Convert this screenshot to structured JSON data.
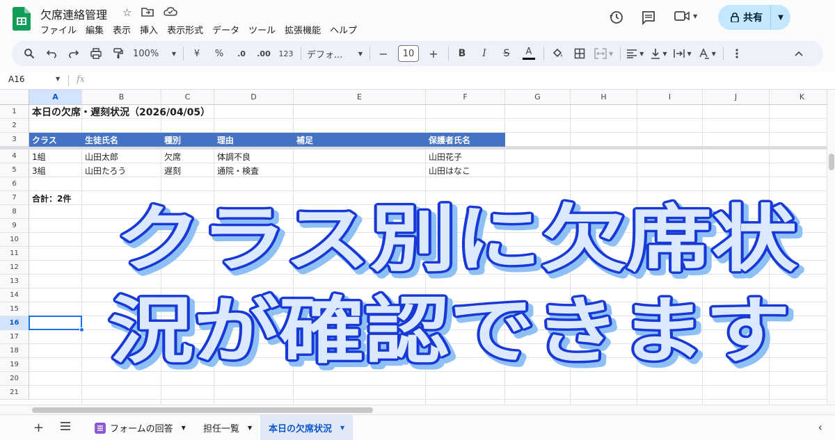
{
  "app": {
    "doc_title": "欠席連絡管理",
    "menu": [
      "ファイル",
      "編集",
      "表示",
      "挿入",
      "表示形式",
      "データ",
      "ツール",
      "拡張機能",
      "ヘルプ"
    ],
    "share_label": "共有"
  },
  "toolbar": {
    "zoom": "100%",
    "currency": "¥",
    "percent": "%",
    "dec_less": ".0",
    "dec_more": ".00",
    "number_format": "123",
    "font_name": "デフォ...",
    "font_size": "10",
    "bold": "B",
    "italic": "I",
    "strike": "S",
    "text_color": "A"
  },
  "formula_bar": {
    "name_box": "A16",
    "fx": "fx"
  },
  "columns": [
    "A",
    "B",
    "C",
    "D",
    "E",
    "F",
    "G",
    "H",
    "I",
    "J",
    "K"
  ],
  "rows": [
    "1",
    "2",
    "3",
    "4",
    "5",
    "6",
    "7",
    "8",
    "9",
    "10",
    "11",
    "12",
    "13",
    "14",
    "15",
    "16",
    "17",
    "18",
    "19",
    "20",
    "21"
  ],
  "selected_cell": {
    "col": "A",
    "row": "16"
  },
  "sheet": {
    "title": "本日の欠席・遅刻状況（2026/04/05）",
    "headers": [
      "クラス",
      "生徒氏名",
      "種別",
      "理由",
      "補足",
      "保護者氏名"
    ],
    "records": [
      [
        "1組",
        "山田太郎",
        "欠席",
        "体調不良",
        "",
        "山田花子"
      ],
      [
        "3組",
        "山田たろう",
        "遅刻",
        "通院・検査",
        "",
        "山田はなこ"
      ]
    ],
    "total": "合計：2件"
  },
  "tabs": [
    {
      "label": "フォームの回答",
      "active": false
    },
    {
      "label": "担任一覧",
      "active": false
    },
    {
      "label": "本日の欠席状況",
      "active": true
    }
  ],
  "overlay": {
    "line1": "クラス別に欠席状",
    "line2": "況が確認できます"
  },
  "colors": {
    "header_band": "#4472c4",
    "selection": "#1a73e8",
    "overlay_stroke": "#1839d6",
    "overlay_fill": "#dbe9ff"
  }
}
